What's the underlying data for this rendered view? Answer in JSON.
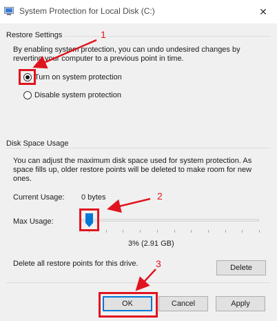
{
  "window": {
    "title": "System Protection for Local Disk (C:)",
    "close_glyph": "✕"
  },
  "restore_settings": {
    "group_title": "Restore Settings",
    "description_line1": "By enabling system protection, you can undo undesired changes by",
    "description_line2": "reverting your computer to a previous point in time.",
    "options": [
      {
        "label": "Turn on system protection",
        "checked": true
      },
      {
        "label": "Disable system protection",
        "checked": false
      }
    ]
  },
  "disk_space": {
    "group_title": "Disk Space Usage",
    "description_line1": "You can adjust the maximum disk space used for system protection. As",
    "description_line2": "space fills up, older restore points will be deleted to make room for new",
    "description_line3": "ones.",
    "current_usage_label": "Current Usage:",
    "current_usage_value": "0 bytes",
    "max_usage_label": "Max Usage:",
    "max_usage_percent": 3,
    "max_usage_value": "3% (2.91 GB)",
    "delete_description": "Delete all restore points for this drive.",
    "delete_label": "Delete"
  },
  "buttons": {
    "ok_label": "OK",
    "cancel_label": "Cancel",
    "apply_label": "Apply"
  },
  "annotations": {
    "number_1": "1",
    "number_2": "2",
    "number_3": "3",
    "color": "#e0141e"
  },
  "colors": {
    "accent": "#0078d7",
    "background": "#f0f0f0"
  }
}
